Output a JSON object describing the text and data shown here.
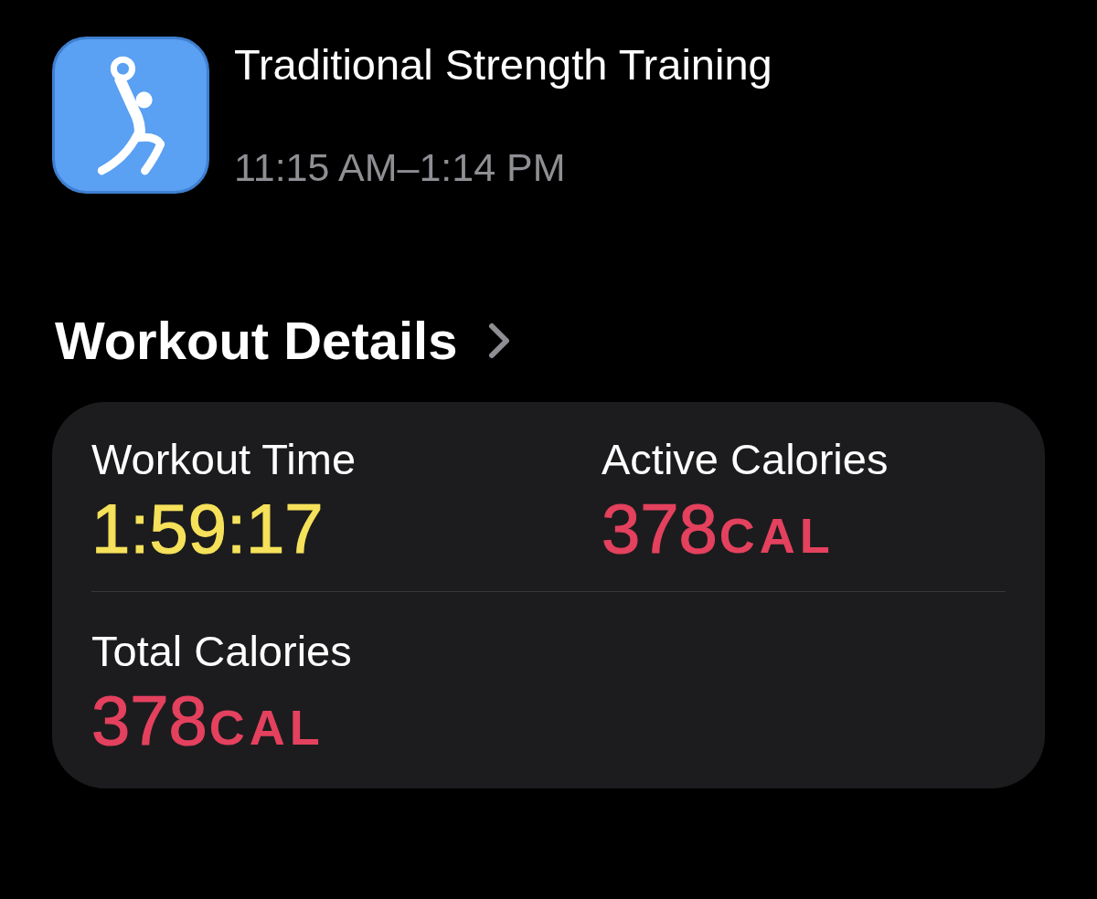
{
  "workout": {
    "title": "Traditional Strength Training",
    "time_range": "11:15 AM–1:14 PM"
  },
  "section": {
    "title": "Workout Details"
  },
  "metrics": [
    {
      "label": "Workout Time",
      "value": "1:59:17",
      "color": "#f6e15a"
    },
    {
      "label": "Active Calories",
      "value": "378",
      "unit": "CAL",
      "color": "#e4415e"
    },
    {
      "label": "Total Calories",
      "value": "378",
      "unit": "CAL",
      "color": "#e4415e"
    }
  ]
}
